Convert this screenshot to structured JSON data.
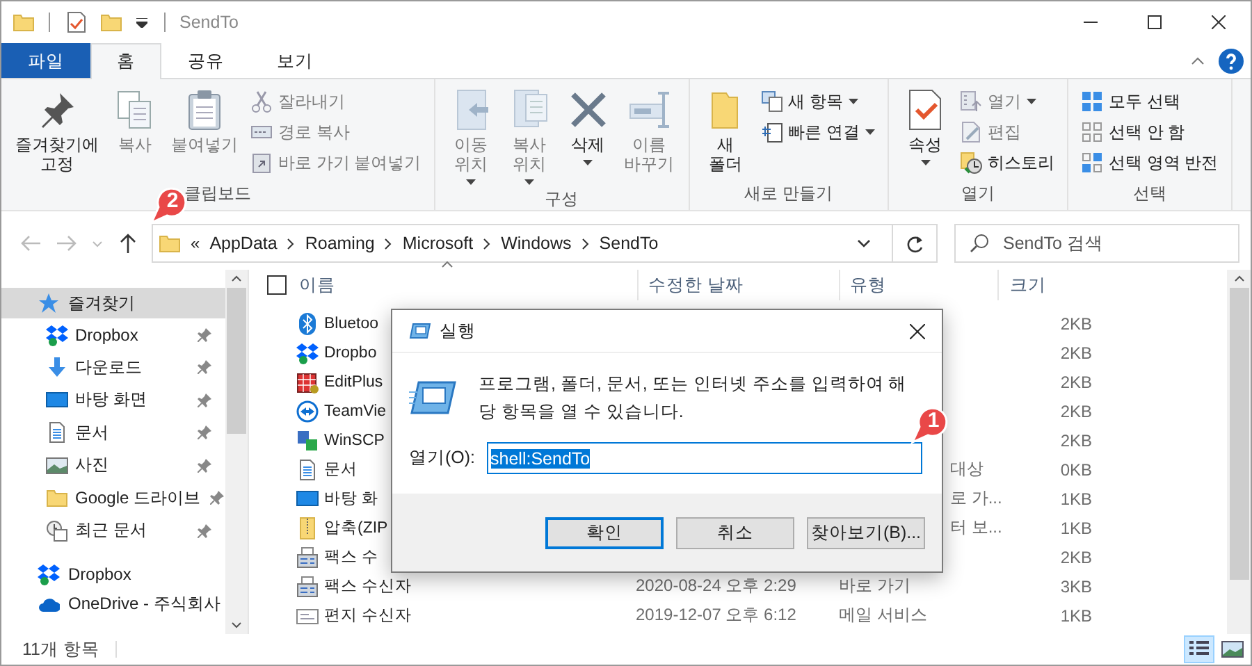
{
  "window": {
    "title": "SendTo"
  },
  "ribbon_tabs": [
    {
      "label": "파일",
      "kind": "file",
      "selected": false
    },
    {
      "label": "홈",
      "kind": "tab",
      "selected": true
    },
    {
      "label": "공유",
      "kind": "tab",
      "selected": false
    },
    {
      "label": "보기",
      "kind": "tab",
      "selected": false
    }
  ],
  "ribbon_groups": [
    {
      "label": "클립보드",
      "buttons": [
        {
          "label": "즐겨찾기에\n고정",
          "kind": "large",
          "disabled": false,
          "menu": false
        },
        {
          "label": "복사",
          "kind": "large",
          "disabled": true,
          "menu": false
        },
        {
          "label": "붙여넣기",
          "kind": "large",
          "disabled": true,
          "menu": false
        },
        {
          "label": "잘라내기",
          "kind": "small",
          "disabled": true,
          "menu": false
        },
        {
          "label": "경로 복사",
          "kind": "small",
          "disabled": true,
          "menu": false
        },
        {
          "label": "바로 가기 붙여넣기",
          "kind": "small",
          "disabled": true,
          "menu": false
        }
      ]
    },
    {
      "label": "구성",
      "buttons": [
        {
          "label": "이동\n위치",
          "kind": "large",
          "disabled": true,
          "menu": true
        },
        {
          "label": "복사\n위치",
          "kind": "large",
          "disabled": true,
          "menu": true
        },
        {
          "label": "삭제",
          "kind": "large",
          "disabled": false,
          "menu": true
        },
        {
          "label": "이름\n바꾸기",
          "kind": "large",
          "disabled": true,
          "menu": false
        }
      ]
    },
    {
      "label": "새로 만들기",
      "buttons": [
        {
          "label": "새\n폴더",
          "kind": "large",
          "disabled": false,
          "menu": false
        },
        {
          "label": "새 항목",
          "kind": "small",
          "disabled": false,
          "menu": true
        },
        {
          "label": "빠른 연결",
          "kind": "small",
          "disabled": false,
          "menu": true
        }
      ]
    },
    {
      "label": "열기",
      "buttons": [
        {
          "label": "속성",
          "kind": "large",
          "disabled": false,
          "menu": true
        },
        {
          "label": "열기",
          "kind": "small",
          "disabled": true,
          "menu": true
        },
        {
          "label": "편집",
          "kind": "small",
          "disabled": true,
          "menu": false
        },
        {
          "label": "히스토리",
          "kind": "small",
          "disabled": false,
          "menu": false
        }
      ]
    },
    {
      "label": "선택",
      "buttons": [
        {
          "label": "모두 선택",
          "kind": "small",
          "disabled": false,
          "menu": false
        },
        {
          "label": "선택 안 함",
          "kind": "small",
          "disabled": false,
          "menu": false
        },
        {
          "label": "선택 영역 반전",
          "kind": "small",
          "disabled": false,
          "menu": false
        }
      ]
    }
  ],
  "address": {
    "overflow": "«",
    "crumbs": [
      "AppData",
      "Roaming",
      "Microsoft",
      "Windows",
      "SendTo"
    ]
  },
  "search": {
    "placeholder": "SendTo 검색"
  },
  "sidebar": {
    "items": [
      {
        "label": "즐겨찾기",
        "kind": "star",
        "selected": true,
        "children": [
          {
            "label": "Dropbox",
            "kind": "dropbox",
            "selected": false,
            "pinned": true
          },
          {
            "label": "다운로드",
            "kind": "download",
            "selected": false,
            "pinned": true
          },
          {
            "label": "바탕 화면",
            "kind": "desktop",
            "selected": false,
            "pinned": true
          },
          {
            "label": "문서",
            "kind": "document",
            "selected": false,
            "pinned": true
          },
          {
            "label": "사진",
            "kind": "pictures",
            "selected": false,
            "pinned": true
          },
          {
            "label": "Google 드라이브",
            "kind": "folder",
            "selected": false,
            "pinned": true
          },
          {
            "label": "최근 문서",
            "kind": "recent",
            "selected": false,
            "pinned": true
          }
        ]
      },
      {
        "label": "Dropbox",
        "kind": "dropbox",
        "selected": false
      },
      {
        "label": "OneDrive - 주식회사",
        "kind": "onedrive",
        "selected": false
      }
    ]
  },
  "table": {
    "select_all": {
      "checked": false
    },
    "columns": [
      "이름",
      "수정한 날짜",
      "유형",
      "크기"
    ],
    "rows": [
      {
        "name": "Bluetoo",
        "kind": "bluetooth",
        "size": "2KB"
      },
      {
        "name": "Dropbo",
        "kind": "dropbox",
        "size": "2KB"
      },
      {
        "name": "EditPlus",
        "kind": "editor",
        "size": "2KB"
      },
      {
        "name": "TeamVie",
        "kind": "remote",
        "size": "2KB"
      },
      {
        "name": "WinSCP",
        "kind": "transfer",
        "size": "2KB"
      },
      {
        "name": "문서",
        "kind": "document",
        "type": "대상",
        "size": "0KB"
      },
      {
        "name": "바탕 화",
        "kind": "desktop",
        "type": "로 가...",
        "size": "1KB"
      },
      {
        "name": "압축(ZIP",
        "kind": "zip",
        "type": "터 보...",
        "size": "1KB"
      },
      {
        "name": "팩스 수",
        "kind": "fax",
        "size": "2KB"
      },
      {
        "name": "팩스 수신자",
        "kind": "fax",
        "date": "2020-08-24 오후 2:29",
        "type": "바로 가기",
        "size": "3KB"
      },
      {
        "name": "편지 수신자",
        "kind": "mail",
        "date": "2019-12-07 오후 6:12",
        "type": "메일 서비스",
        "size": "1KB"
      }
    ]
  },
  "status_bar": {
    "count": "11개 항목",
    "views": [
      {
        "kind": "details",
        "selected": true
      },
      {
        "kind": "large",
        "selected": false
      }
    ]
  },
  "run_dialog": {
    "title": "실행",
    "message": "프로그램, 폴더, 문서, 또는 인터넷 주소를 입력하여 해당 항목을 열 수 있습니다.",
    "open_label": "열기(O):",
    "value": "shell:SendTo",
    "value_selected": true,
    "buttons": [
      {
        "label": "확인",
        "default": true
      },
      {
        "label": "취소",
        "default": false
      },
      {
        "label": "찾아보기(B)...",
        "default": false
      }
    ]
  },
  "callouts": [
    {
      "number": "1"
    },
    {
      "number": "2"
    }
  ]
}
